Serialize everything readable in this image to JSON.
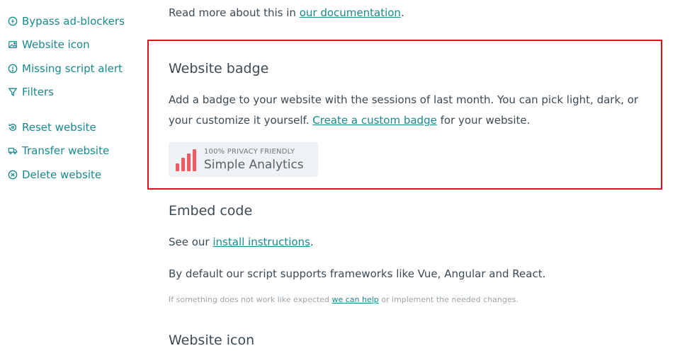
{
  "sidebar": {
    "group1": [
      {
        "label": "Bypass ad-blockers",
        "icon": "shield-icon"
      },
      {
        "label": "Website icon",
        "icon": "image-icon"
      },
      {
        "label": "Missing script alert",
        "icon": "alert-icon"
      },
      {
        "label": "Filters",
        "icon": "filter-icon"
      }
    ],
    "group2": [
      {
        "label": "Reset website",
        "icon": "reset-icon"
      },
      {
        "label": "Transfer website",
        "icon": "truck-icon"
      },
      {
        "label": "Delete website",
        "icon": "x-circle-icon"
      }
    ]
  },
  "intro": {
    "text": "Read more about this in ",
    "link": "our documentation",
    "after": "."
  },
  "badge_section": {
    "title": "Website badge",
    "line1": "Add a badge to your website with the sessions of last month. You can pick light, dark, or",
    "line2_before": "your customize it yourself. ",
    "line2_link": "Create a custom badge",
    "line2_after": " for your website.",
    "badge": {
      "tagline": "100% PRIVACY FRIENDLY",
      "name": "Simple Analytics",
      "bar_heights": [
        0.35,
        0.6,
        0.8,
        1.0
      ],
      "bar_color": "#f05a61"
    }
  },
  "embed_section": {
    "title": "Embed code",
    "see_before": "See our ",
    "see_link": "install instructions",
    "see_after": ".",
    "frameworks": "By default our script supports frameworks like Vue, Angular and React.",
    "help_before": "If something does not work like expected ",
    "help_link": "we can help",
    "help_after": " or implement the needed changes."
  },
  "icon_section": {
    "title": "Website icon"
  },
  "colors": {
    "accent": "#17898f",
    "text": "#3b4a55",
    "highlight_border": "#e0101a"
  }
}
